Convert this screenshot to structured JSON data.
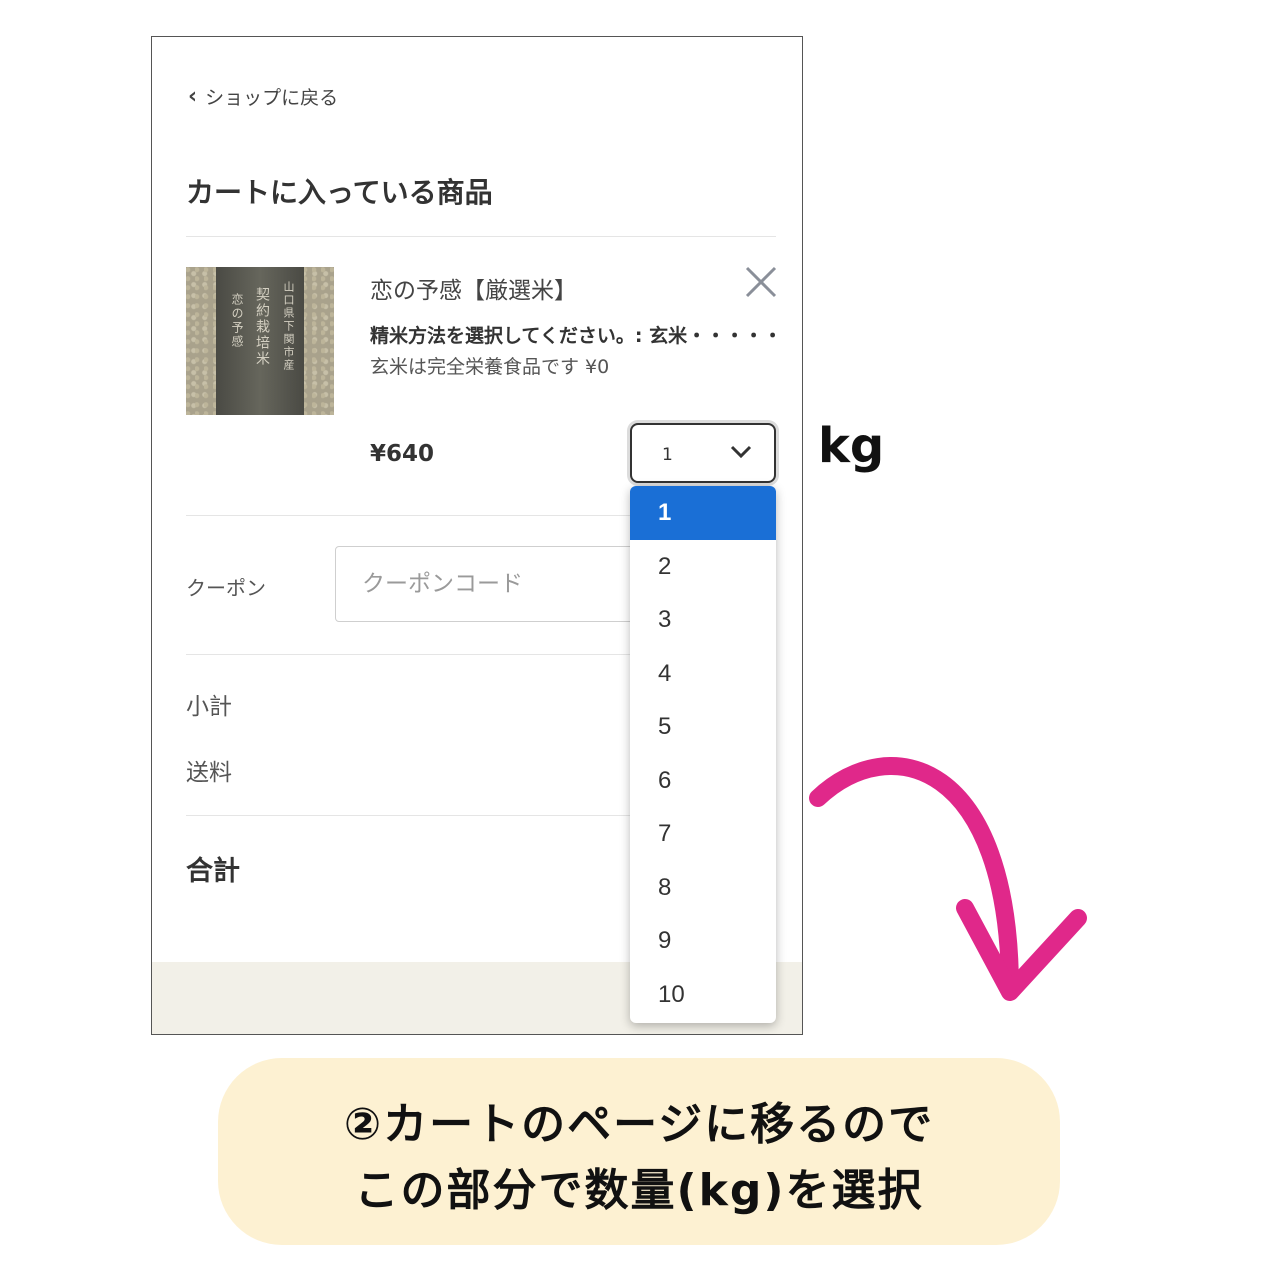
{
  "header": {
    "back_label": "ショップに戻る",
    "page_title": "カートに入っている商品"
  },
  "cart_item": {
    "name": "恋の予感【厳選米】",
    "option_line1": "精米方法を選択してください。: 玄米・・・・・",
    "option_line2": "玄米は完全栄養食品です ¥0",
    "price": "¥640",
    "quantity": "1",
    "image_text": {
      "col1": "山口県下関市産",
      "col2": "契約栽培米",
      "col3": "恋の予感"
    }
  },
  "quantity_options": [
    "1",
    "2",
    "3",
    "4",
    "5",
    "6",
    "7",
    "8",
    "9",
    "10"
  ],
  "coupon": {
    "label": "クーポン",
    "placeholder": "クーポンコード"
  },
  "summary": {
    "subtotal_label": "小計",
    "shipping_label": "送料",
    "total_label": "合計"
  },
  "annotation": {
    "unit": "kg",
    "caption_line1": "②カートのページに移るので",
    "caption_line2": "この部分で数量(kg)を選択"
  },
  "colors": {
    "selected_option": "#1a6fd6",
    "arrow": "#e0288a",
    "caption_bg": "#fdf1d2"
  }
}
